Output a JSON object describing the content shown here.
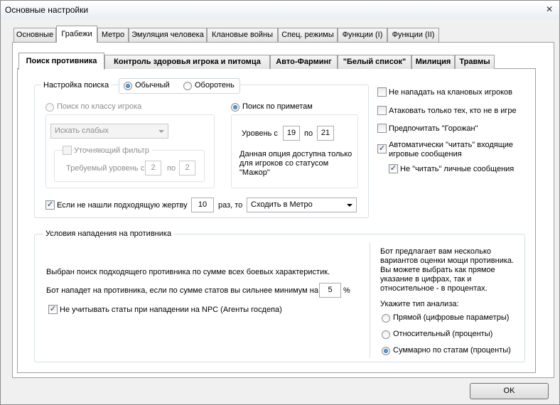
{
  "window": {
    "title": "Основные настройки",
    "close": "✕"
  },
  "tabs": [
    "Основные",
    "Грабежи",
    "Метро",
    "Эмуляция человека",
    "Клановые войны",
    "Спец. режимы",
    "Функции (I)",
    "Функции (II)"
  ],
  "subtabs": [
    "Поиск противника",
    "Контроль здоровья игрока и питомца",
    "Авто-Фарминг",
    "\"Белый список\"",
    "Милиция",
    "Травмы"
  ],
  "search": {
    "legend": "Настройка поиска",
    "mode_normal": "Обычный",
    "mode_werewolf": "Оборотень",
    "by_class": "Поиск по классу игрока",
    "class_select": "Искать слабых",
    "refine_filter": "Уточняющий фильтр",
    "required_level": "Требуемый уровень с",
    "req_from": "2",
    "req_to_label": "по",
    "req_to": "2",
    "by_signs": "Поиск по приметам",
    "level_from_label": "Уровень с",
    "level_from": "19",
    "level_to_label": "по",
    "level_to": "21",
    "note_line1": "Данная опция доступна только",
    "note_line2": "для игроков со статусом",
    "note_line3": "\"Мажор\"",
    "fallback_label": "Если не нашли подходящую жертву",
    "fallback_count": "10",
    "fallback_times": "раз, то",
    "fallback_action": "Сходить в Метро"
  },
  "options": {
    "no_clan": "Не нападать на клановых игроков",
    "not_in_game": "Атаковать только тех, кто не в игре",
    "prefer_city": "Предпочитать \"Горожан\"",
    "auto_read_1": "Автоматически \"читать\" входящие",
    "auto_read_2": "игровые сообщения",
    "no_read_personal": "Не \"читать\" личные сообщения"
  },
  "attack": {
    "legend": "Условия нападения на противника",
    "chosen": "Выбран поиск подходящего противника по сумме всех боевых характеристик.",
    "stronger": "Бот нападет на противника, если по сумме статов вы сильнее минимум на",
    "percent": "5",
    "percent_sign": "%",
    "ignore_npc": "Не учитывать статы при нападении на NPC (Агенты госдепа)",
    "desc_1": "Бот предлагает вам несколько",
    "desc_2": "вариантов оценки мощи противника.",
    "desc_3": "Вы можете выбрать как прямое",
    "desc_4": "указание в цифрах, так и",
    "desc_5": "относительное - в процентах.",
    "analysis_label": "Укажите тип анализа:",
    "direct": "Прямой (цифровые параметры)",
    "relative": "Относительный (проценты)",
    "sum_stats": "Суммарно по статам (проценты)"
  },
  "ok_label": "OK"
}
